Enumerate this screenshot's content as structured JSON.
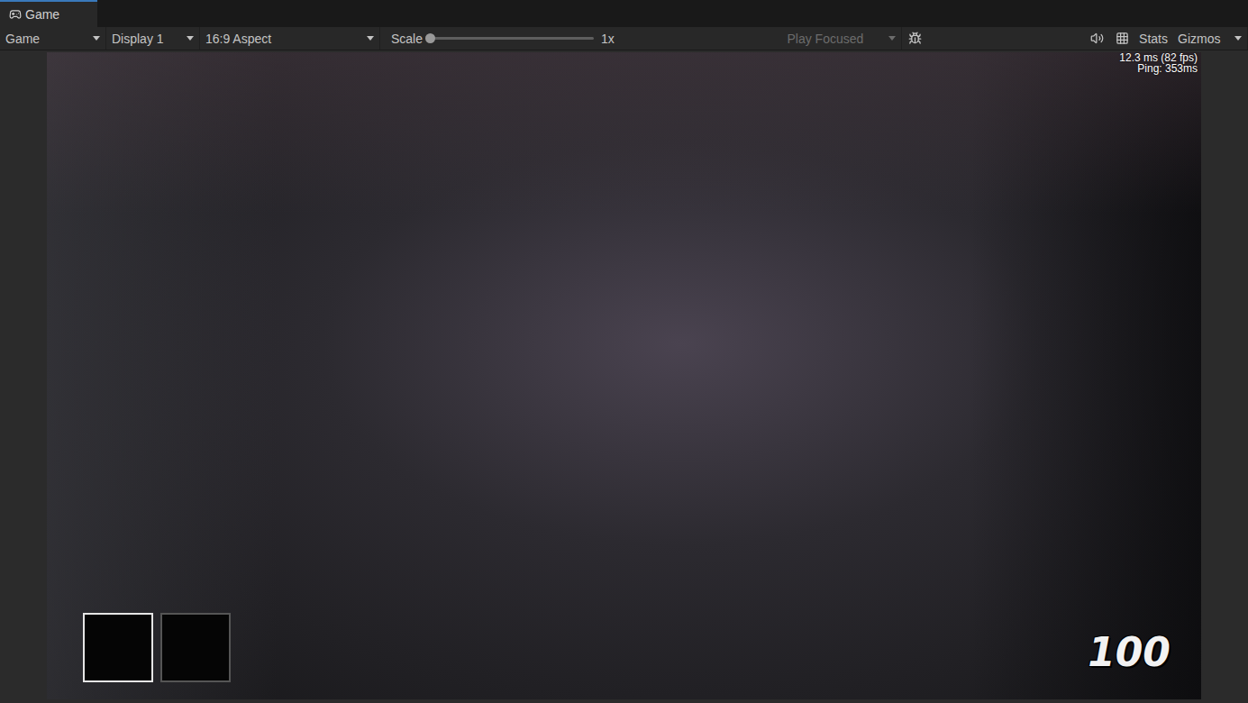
{
  "window": {
    "title": "Game"
  },
  "toolbar": {
    "dropdowns": [
      {
        "label": "Game"
      },
      {
        "label": "Display 1"
      },
      {
        "label": "16:9 Aspect"
      }
    ],
    "scale": {
      "label": "Scale",
      "level": 0,
      "reading": "1x"
    },
    "play_mode": {
      "label": "Play Focused",
      "disabled": true
    },
    "stats": {
      "label": "Stats"
    },
    "gizmos": {
      "label": "Gizmos"
    }
  },
  "hud": {
    "frame_time": "12.3 ms (82 fps)",
    "ping": "Ping: 353ms",
    "slots": [
      {
        "selected": true
      },
      {
        "selected": false
      }
    ],
    "health": "100"
  }
}
